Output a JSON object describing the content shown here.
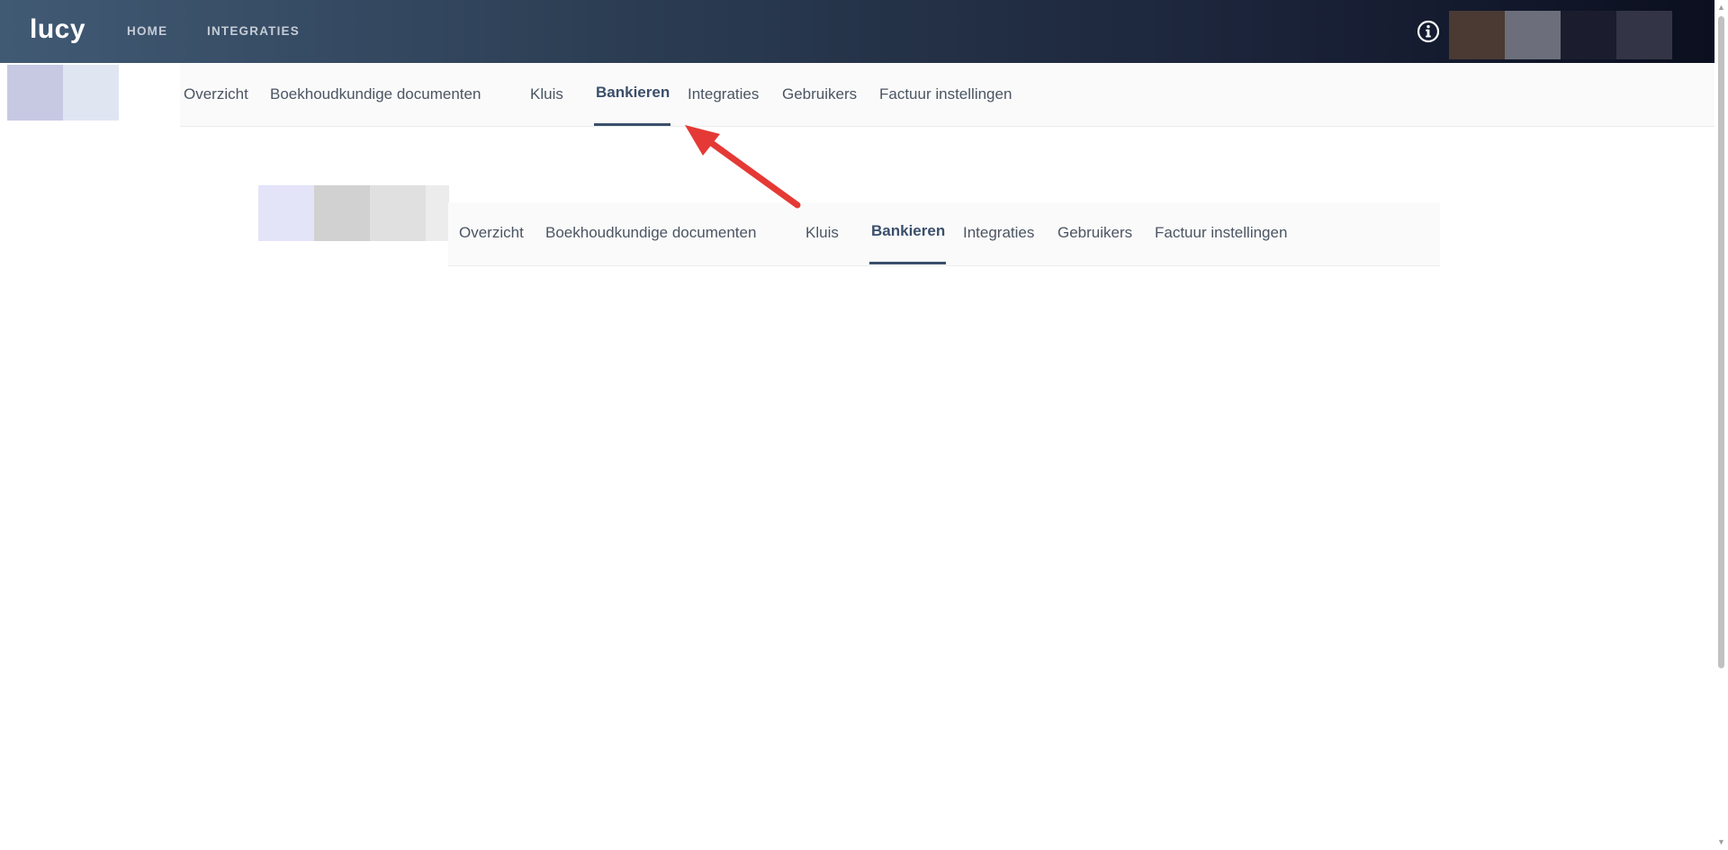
{
  "header": {
    "logo": "lucy",
    "nav": [
      "HOME",
      "INTEGRATIES"
    ],
    "info_icon": "info-circle-icon"
  },
  "subnav_main": {
    "tabs": [
      "Overzicht",
      "Boekhoudkundige documenten",
      "Kluis",
      "Bankieren",
      "Integraties",
      "Gebruikers",
      "Factuur instellingen"
    ],
    "active_tab": "Bankieren"
  },
  "subnav_preview": {
    "tabs": [
      "Overzicht",
      "Boekhoudkundige documenten",
      "Kluis",
      "Bankieren",
      "Integraties",
      "Gebruikers",
      "Factuur instellingen"
    ],
    "active_tab": "Bankieren"
  },
  "colors": {
    "header_start": "#415a74",
    "header_end": "#0b0f1f",
    "active_tab": "#3b4f6b",
    "annotation_arrow": "#e53935"
  },
  "scrollbar": {
    "up_icon": "scroll-up-arrow-icon",
    "down_icon": "scroll-down-arrow-icon"
  }
}
